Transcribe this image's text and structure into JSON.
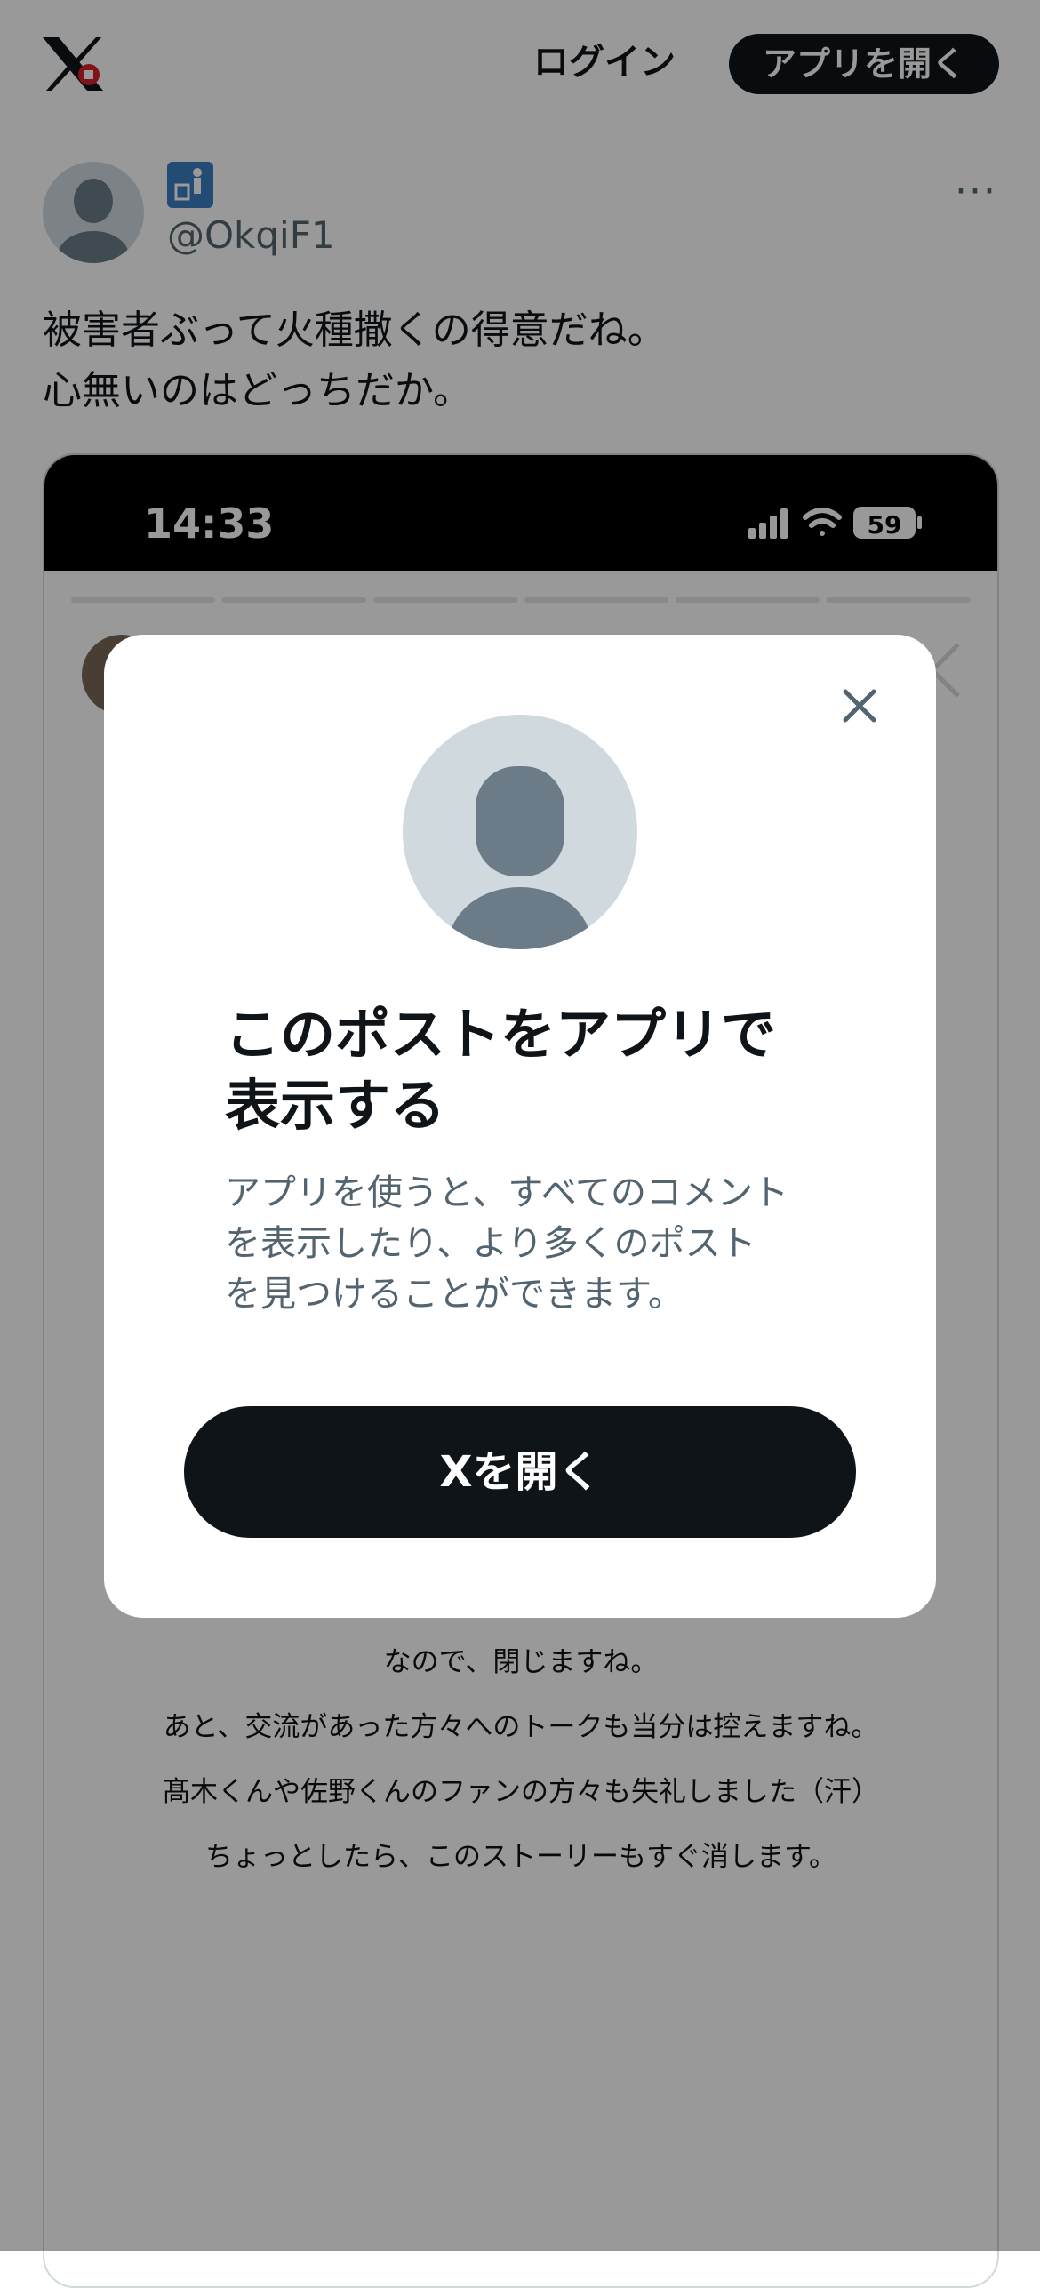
{
  "header": {
    "logo_icon": "x-logo-icon",
    "login_label": "ログイン",
    "open_app_label": "アプリを開く"
  },
  "post": {
    "avatar_icon": "default-avatar-icon",
    "badge_icon": "trash-person-icon",
    "handle": "@OkqiF1",
    "more_icon": "more-icon",
    "more_label": "···",
    "text_lines": [
      "被害者ぶって火種撒くの得意だね。",
      "心無いのはどっちだか。"
    ]
  },
  "media": {
    "clock": "14:33",
    "battery": "59",
    "story_lines": [
      "なので、閉じますね。",
      "あと、交流があった方々へのトークも当分は控えますね。",
      "髙木くんや佐野くんのファンの方々も失礼しました（汗）",
      "ちょっとしたら、このストーリーもすぐ消します。"
    ]
  },
  "modal": {
    "close_icon": "close-icon",
    "title_lines": [
      "このポストをアプリで",
      "表示する"
    ],
    "desc_lines": [
      "アプリを使うと、すべてのコメント",
      "を表示したり、より多くのポスト",
      "を見つけることができます。"
    ],
    "button_label": "Xを開く"
  },
  "colors": {
    "primary_dark": "#0f1419",
    "secondary_text": "#536471",
    "avatar_bg": "#cfd9de",
    "avatar_fg": "#6b7c88"
  }
}
